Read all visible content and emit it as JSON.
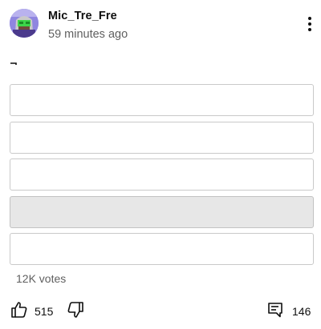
{
  "post": {
    "author": "Mic_Tre_Fre",
    "timestamp": "59 minutes ago",
    "text_glyph": "⌐",
    "avatar_icon": "avatar-icon",
    "menu_icon": "more-vertical-icon"
  },
  "poll": {
    "options": [
      {
        "label": "",
        "selected": false
      },
      {
        "label": "",
        "selected": false
      },
      {
        "label": "",
        "selected": false
      },
      {
        "label": "",
        "selected": true
      },
      {
        "label": "",
        "selected": false
      }
    ],
    "votes": "12K votes"
  },
  "actions": {
    "likes": "515",
    "comments": "146",
    "like_icon": "thumbs-up-icon",
    "dislike_icon": "thumbs-down-icon",
    "comment_icon": "comment-icon"
  },
  "colors": {
    "text_primary": "#0f0f0f",
    "text_secondary": "#606060",
    "option_border": "#c9c9c9",
    "option_selected_bg": "#e7e7e7",
    "avatar_bg": "#8f86e0"
  }
}
